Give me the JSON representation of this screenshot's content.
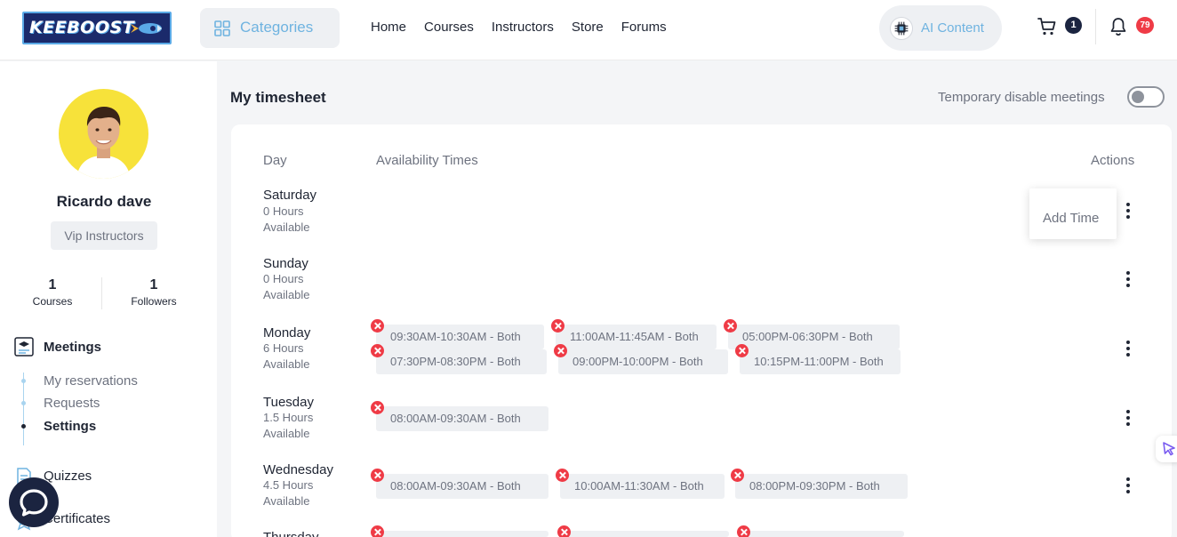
{
  "header": {
    "logo_text": "KEEBOOST",
    "categories_label": "Categories",
    "nav": [
      "Home",
      "Courses",
      "Instructors",
      "Store",
      "Forums"
    ],
    "ai_label": "AI Content",
    "cart_count": "1",
    "notifications_count": "79"
  },
  "profile": {
    "name": "Ricardo dave",
    "badge": "Vip Instructors",
    "stats": [
      {
        "num": "1",
        "label": "Courses"
      },
      {
        "num": "1",
        "label": "Followers"
      }
    ]
  },
  "sidebar": {
    "meetings_label": "Meetings",
    "sub_items": [
      "My reservations",
      "Requests",
      "Settings"
    ],
    "quizzes_label": "Quizzes",
    "certificates_label": "Certificates"
  },
  "main": {
    "title": "My timesheet",
    "toggle_label": "Temporary disable meetings",
    "col_day": "Day",
    "col_times": "Availability Times",
    "col_actions": "Actions",
    "dropdown_item": "Add Time",
    "days": [
      {
        "name": "Saturday",
        "hours": "0 Hours",
        "available": "Available"
      },
      {
        "name": "Sunday",
        "hours": "0 Hours",
        "available": "Available"
      },
      {
        "name": "Monday",
        "hours": "6 Hours",
        "available": "Available"
      },
      {
        "name": "Tuesday",
        "hours": "1.5 Hours",
        "available": "Available"
      },
      {
        "name": "Wednesday",
        "hours": "4.5 Hours",
        "available": "Available"
      },
      {
        "name": "Thursday"
      }
    ],
    "monday_slots": [
      "09:30AM-10:30AM  -  Both",
      "11:00AM-11:45AM  -  Both",
      "05:00PM-06:30PM  -  Both",
      "07:30PM-08:30PM  -  Both",
      "09:00PM-10:00PM  -  Both",
      "10:15PM-11:00PM  -  Both"
    ],
    "tuesday_slots": [
      "08:00AM-09:30AM  -  Both"
    ],
    "wednesday_slots": [
      "08:00AM-09:30AM  -  Both",
      "10:00AM-11:30AM  -  Both",
      "08:00PM-09:30PM  -  Both"
    ]
  }
}
